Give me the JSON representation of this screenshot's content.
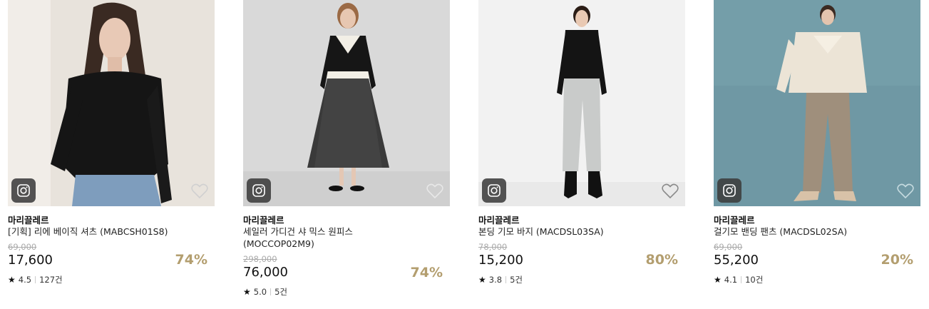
{
  "products": [
    {
      "brand": "마리끌레르",
      "name": "[기획] 리에 베이직 셔츠 (MABCSH01S8)",
      "original_price": "69,000",
      "price": "17,600",
      "discount": "74%",
      "rating": "4.5",
      "reviews": "127건",
      "image_bg": "#e8e3dc"
    },
    {
      "brand": "마리끌레르",
      "name": "세일러 가디건 샤 믹스 원피스 (MOCCOP02M9)",
      "original_price": "298,000",
      "price": "76,000",
      "discount": "74%",
      "rating": "5.0",
      "reviews": "5건",
      "image_bg": "#d9d9d9"
    },
    {
      "brand": "마리끌레르",
      "name": "본딩 기모 바지 (MACDSL03SA)",
      "original_price": "78,000",
      "price": "15,200",
      "discount": "80%",
      "rating": "3.8",
      "reviews": "5건",
      "image_bg": "#f2f2f2"
    },
    {
      "brand": "마리끌레르",
      "name": "걸기모 밴딩 팬츠 (MACDSL02SA)",
      "original_price": "69,000",
      "price": "55,200",
      "discount": "20%",
      "rating": "4.1",
      "reviews": "10건",
      "image_bg": "#6f98a4"
    }
  ],
  "icons": {
    "instagram": "instagram-icon",
    "wishlist": "heart-icon",
    "rating": "star-icon"
  },
  "colors": {
    "discount": "#b39e6f",
    "original_price": "#aaaaaa"
  }
}
